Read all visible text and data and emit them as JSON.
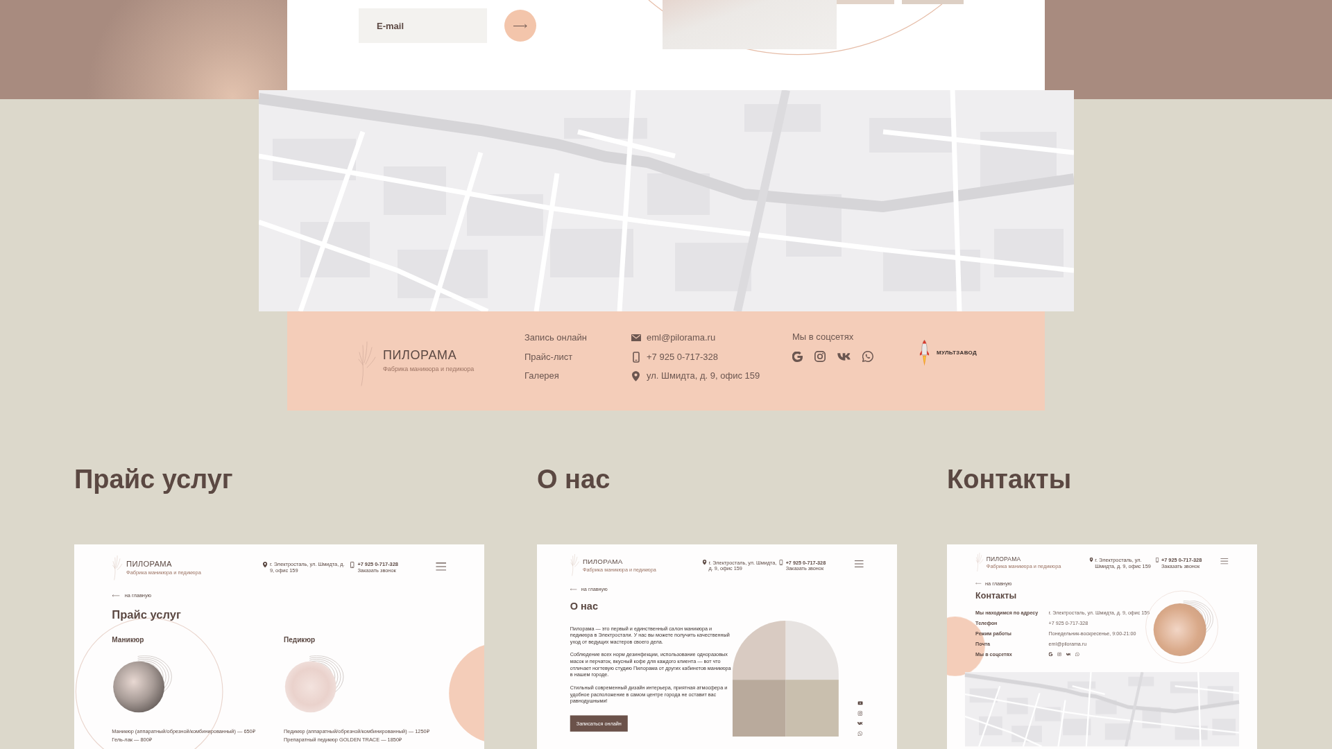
{
  "subscribe": {
    "email_field": {
      "placeholder": "E-mail"
    }
  },
  "footer": {
    "brand": "ПИЛОРАМА",
    "tagline": "Фабрика маникюра и педикюра",
    "nav": [
      "Запись онлайн",
      "Прайс-лист",
      "Галерея"
    ],
    "contacts": [
      {
        "kind": "email",
        "text": "eml@pilorama.ru"
      },
      {
        "kind": "phone",
        "text": "+7 925 0-717-328"
      },
      {
        "kind": "address",
        "text": "ул. Шмидта, д. 9, офис 159"
      }
    ],
    "social_title": "Мы в соцсетях",
    "social": [
      {
        "kind": "google"
      },
      {
        "kind": "instagram"
      },
      {
        "kind": "vk"
      },
      {
        "kind": "whatsapp"
      }
    ],
    "credit": "МУЛЬТЗАВОД"
  },
  "sections": [
    {
      "kind": "price",
      "title": "Прайс услуг",
      "preview": {
        "header": {
          "brand": "ПИЛОРАМА",
          "tagline": "Фабрика маникюра и педикюра",
          "address": "г. Электросталь, ул. Шмидта, д. 9, офис 159",
          "phone": "+7 925 0-717-328",
          "callback": "Заказать звонок"
        },
        "back_link": "на главную",
        "heading": "Прайс услуг",
        "columns": [
          {
            "title": "Маникюр",
            "items": [
              "Маникюр (аппаратный/обрезной/комбинированный) — 650₽",
              "Гель-лак — 800₽"
            ]
          },
          {
            "title": "Педикюр",
            "items": [
              "Педикюр (аппаратный/обрезной/комбинированный) — 1250₽",
              "Препаратный педикюр GOLDEN TRACE — 1850₽"
            ]
          }
        ]
      }
    },
    {
      "kind": "about",
      "title": "О нас",
      "preview": {
        "header": {
          "brand": "ПИЛОРАМА",
          "tagline": "Фабрика маникюра и педикюра",
          "address": "г. Электросталь, ул. Шмидта, д. 9, офис 159",
          "phone": "+7 925 0-717-328",
          "callback": "Заказать звонок"
        },
        "back_link": "на главную",
        "heading": "О нас",
        "paragraphs": [
          "Пилорама — это первый и единственный салон маникюра и педикюра в Электростали. У нас вы можете получить качественный уход от ведущих мастеров своего дела.",
          "Соблюдение всех норм дезинфекции, использование одноразовых масок и перчаток, вкусный кофе для каждого клиента — вот что отличает ногтевую студию Пилорама от других кабинетов маникюра в нашем городе.",
          "Стильный современный дизайн интерьера, приятная атмосфера и удобное расположение в самом центре города не оставит вас равнодушными!"
        ],
        "button": "Записаться онлайн",
        "social": [
          {
            "kind": "youtube"
          },
          {
            "kind": "instagram"
          },
          {
            "kind": "vk"
          },
          {
            "kind": "whatsapp"
          }
        ]
      }
    },
    {
      "kind": "contacts",
      "title": "Контакты",
      "preview": {
        "header": {
          "brand": "ПИЛОРАМА",
          "tagline": "Фабрика маникюра и педикюра",
          "address": "г. Электросталь, ул. Шмидта, д. 9, офис 159",
          "phone": "+7 925 0-717-328",
          "callback": "Заказать звонок"
        },
        "back_link": "на главную",
        "heading": "Контакты",
        "rows": [
          {
            "kind": "text",
            "label": "Мы находимся по адресу",
            "value": "г. Электросталь, ул. Шмидта, д. 9, офис 159"
          },
          {
            "kind": "text",
            "label": "Телефон",
            "value": "+7 925 0-717-328"
          },
          {
            "kind": "text",
            "label": "Режим работы",
            "value": "Понедельник-воскресенье, 9:00-21:00"
          },
          {
            "kind": "text",
            "label": "Почта",
            "value": "eml@pilorama.ru"
          },
          {
            "kind": "social",
            "label": "Мы в соцсетях",
            "social": [
              {
                "kind": "google"
              },
              {
                "kind": "instagram"
              },
              {
                "kind": "vk"
              },
              {
                "kind": "whatsapp"
              }
            ]
          }
        ]
      }
    }
  ]
}
